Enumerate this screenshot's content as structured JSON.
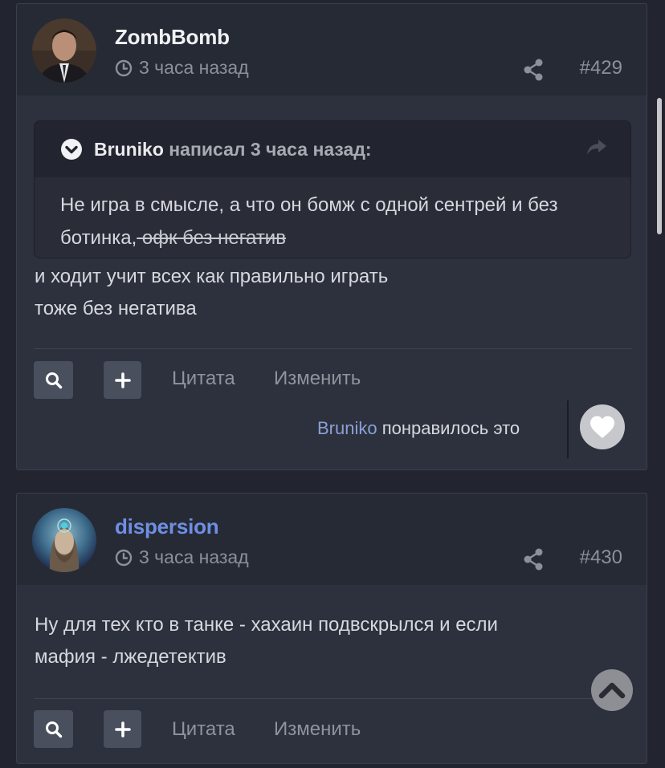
{
  "posts": [
    {
      "author": "ZombBomb",
      "time": "3 часа назад",
      "number": "#429",
      "quote": {
        "author": "Bruniko",
        "meta": "написал 3 часа назад:",
        "text": "Не игра в смысле, а что он бомж с одной сентрей и без ботинка,",
        "struck_text": " офк без негатив"
      },
      "body_lines": [
        "и ходит учит всех как правильно играть",
        "тоже без негатива"
      ],
      "actions": {
        "quote": "Цитата",
        "edit": "Изменить"
      },
      "like": {
        "user": "Bruniko",
        "text": " понравилось это"
      }
    },
    {
      "author": "dispersion",
      "time": "3 часа назад",
      "number": "#430",
      "body_lines": [
        "Ну для тех кто в танке - хахаин подвскрылся и если",
        "мафия - лжедетектив"
      ],
      "actions": {
        "quote": "Цитата",
        "edit": "Изменить"
      }
    }
  ],
  "icons": {
    "clock": "clock-icon",
    "share": "share-icon",
    "search": "search-icon",
    "plus": "plus-icon",
    "heart": "heart-icon",
    "chevron": "chevron-down-icon",
    "reply": "reply-arrow-icon",
    "scroll_top": "chevron-up-icon"
  },
  "colors": {
    "background": "#22252f",
    "card": "#2d313d",
    "header": "#262a35",
    "author_link": "#6f8fe4",
    "liker_link": "#8aa0d6"
  }
}
